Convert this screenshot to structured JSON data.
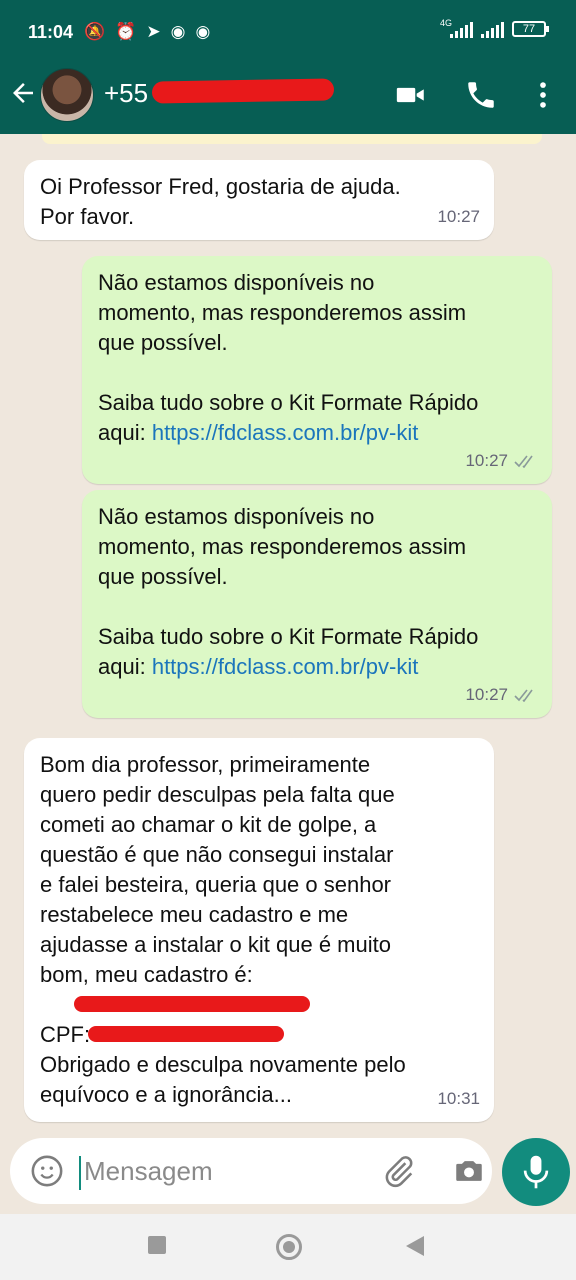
{
  "status_bar": {
    "time": "11:04",
    "network": "4G",
    "battery": "77"
  },
  "header": {
    "contact": "+55"
  },
  "messages": [
    {
      "direction": "in",
      "lines": [
        "Oi Professor Fred, gostaria de ajuda.",
        "Por favor."
      ],
      "time": "10:27"
    },
    {
      "direction": "out",
      "lines": [
        "Não estamos disponíveis no",
        "momento, mas responderemos assim",
        "que possível.",
        "",
        "Saiba tudo sobre o Kit Formate Rápido"
      ],
      "link_prefix": "aqui: ",
      "link": "https://fdclass.com.br/pv-kit",
      "time": "10:27"
    },
    {
      "direction": "out",
      "lines": [
        "Não estamos disponíveis no",
        "momento, mas responderemos assim",
        "que possível.",
        "",
        "Saiba tudo sobre o Kit Formate Rápido"
      ],
      "link_prefix": "aqui: ",
      "link": "https://fdclass.com.br/pv-kit",
      "time": "10:27"
    },
    {
      "direction": "in",
      "lines": [
        "Bom dia professor, primeiramente",
        "quero pedir desculpas pela falta que",
        "cometi ao chamar o kit de golpe, a",
        "questão é que não consegui instalar",
        "e falei besteira, queria que o senhor",
        "restabelece meu cadastro e me",
        "ajudasse a instalar o kit que é muito",
        "bom, meu cadastro é:"
      ],
      "cpf_label": "CPF:",
      "closing": [
        "Obrigado e desculpa novamente pelo",
        "equívoco e a ignorância..."
      ],
      "time": "10:31"
    }
  ],
  "composer": {
    "placeholder": "Mensagem"
  },
  "colors": {
    "header": "#075e54",
    "outgoing_bubble": "#dcf8c6",
    "incoming_bubble": "#ffffff",
    "chat_background": "#efe7dd",
    "link": "#1b75bc",
    "redaction": "#e8191a",
    "mic_button": "#128c7e"
  },
  "icons": [
    "back-arrow-icon",
    "video-call-icon",
    "voice-call-icon",
    "more-options-icon",
    "emoji-icon",
    "attach-icon",
    "camera-icon",
    "mic-icon",
    "double-check-icon"
  ]
}
